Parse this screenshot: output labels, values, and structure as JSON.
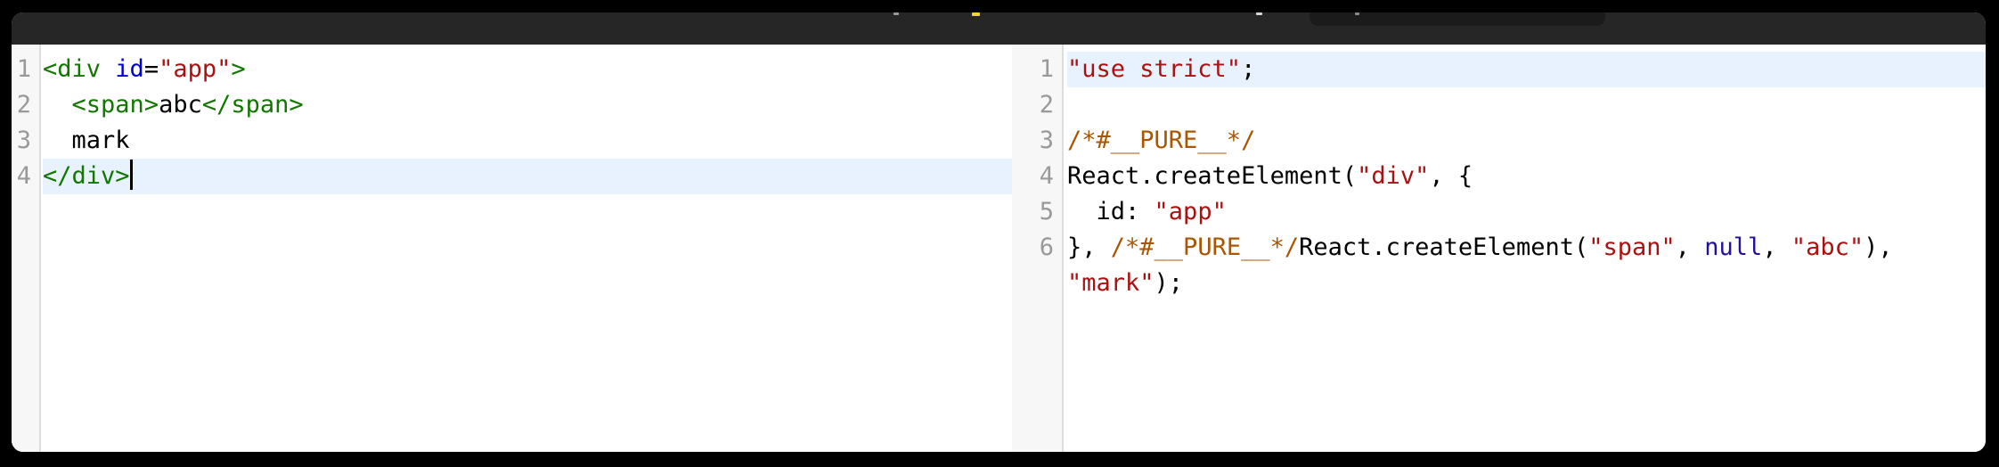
{
  "theme": {
    "ui": {
      "frame_bg": "#000000",
      "header_bg": "#262626",
      "search_bg": "#1b1b1c",
      "content_bg": "#ffffff",
      "gutter_bg": "#f7f7f7",
      "gutter_border": "#dddddd",
      "line_number": "#999999",
      "active_line_bg": "#e8f2ff",
      "logo_remnant_yellow": "#f0d43c"
    },
    "syntax": {
      "tag": "#117700",
      "attr": "#0000cc",
      "str": "#aa1111",
      "cmt": "#aa5500",
      "atom": "#221199",
      "pln": "#000000"
    }
  },
  "editors": {
    "left": {
      "name": "jsx-source-editor",
      "lines": [
        {
          "number": "1",
          "active": false,
          "cursor": false,
          "tokens": [
            {
              "t": "tag",
              "v": "<div"
            },
            {
              "t": "pln",
              "v": " "
            },
            {
              "t": "attr",
              "v": "id"
            },
            {
              "t": "pln",
              "v": "="
            },
            {
              "t": "str",
              "v": "\"app\""
            },
            {
              "t": "tag",
              "v": ">"
            }
          ]
        },
        {
          "number": "2",
          "active": false,
          "cursor": false,
          "tokens": [
            {
              "t": "pln",
              "v": "  "
            },
            {
              "t": "tag",
              "v": "<span>"
            },
            {
              "t": "pln",
              "v": "abc"
            },
            {
              "t": "tag",
              "v": "</span>"
            }
          ]
        },
        {
          "number": "3",
          "active": false,
          "cursor": false,
          "tokens": [
            {
              "t": "pln",
              "v": "  mark"
            }
          ]
        },
        {
          "number": "4",
          "active": true,
          "cursor": true,
          "tokens": [
            {
              "t": "tag",
              "v": "</div>"
            }
          ]
        }
      ]
    },
    "right": {
      "name": "compiled-output-editor",
      "lines": [
        {
          "number": "1",
          "active": true,
          "cursor": false,
          "tokens": [
            {
              "t": "str",
              "v": "\"use strict\""
            },
            {
              "t": "pln",
              "v": ";"
            }
          ]
        },
        {
          "number": "2",
          "active": false,
          "cursor": false,
          "tokens": []
        },
        {
          "number": "3",
          "active": false,
          "cursor": false,
          "tokens": [
            {
              "t": "cmt",
              "v": "/*#__PURE__*/"
            }
          ]
        },
        {
          "number": "4",
          "active": false,
          "cursor": false,
          "tokens": [
            {
              "t": "pln",
              "v": "React.createElement("
            },
            {
              "t": "str",
              "v": "\"div\""
            },
            {
              "t": "pln",
              "v": ", {"
            }
          ]
        },
        {
          "number": "5",
          "active": false,
          "cursor": false,
          "tokens": [
            {
              "t": "pln",
              "v": "  id: "
            },
            {
              "t": "str",
              "v": "\"app\""
            }
          ]
        },
        {
          "number": "6",
          "active": false,
          "cursor": false,
          "tokens": [
            {
              "t": "pln",
              "v": "}, "
            },
            {
              "t": "cmt",
              "v": "/*#__PURE__*/"
            },
            {
              "t": "pln",
              "v": "React.createElement("
            },
            {
              "t": "str",
              "v": "\"span\""
            },
            {
              "t": "pln",
              "v": ", "
            },
            {
              "t": "atom",
              "v": "null"
            },
            {
              "t": "pln",
              "v": ", "
            },
            {
              "t": "str",
              "v": "\"abc\""
            },
            {
              "t": "pln",
              "v": "),"
            }
          ]
        },
        {
          "number": "",
          "active": false,
          "cursor": false,
          "tokens": [
            {
              "t": "str",
              "v": "\"mark\""
            },
            {
              "t": "pln",
              "v": ");"
            }
          ]
        }
      ]
    }
  }
}
